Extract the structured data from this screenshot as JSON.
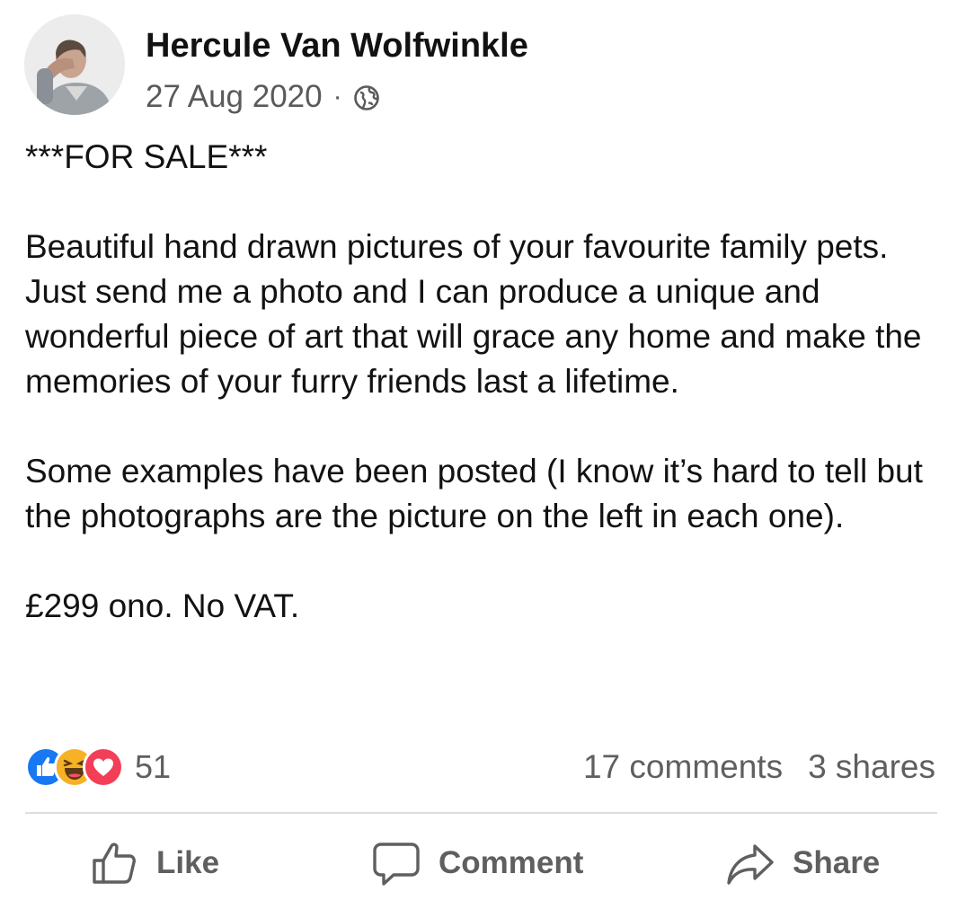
{
  "post": {
    "author": "Hercule Van Wolfwinkle",
    "date": "27 Aug 2020",
    "separator": "·",
    "privacy_icon": "globe-icon",
    "body": {
      "heading": "***FOR SALE***",
      "paragraph1": "Beautiful hand drawn pictures of your favourite family pets. Just send me a photo and I can produce a unique and wonderful piece of art that will grace any home and make the memories of your furry friends last a lifetime.",
      "paragraph2": "Some examples have been posted (I know it’s hard to tell but the photographs are the picture on the left in each one).",
      "price": "£299 ono. No VAT."
    }
  },
  "stats": {
    "reactions": [
      {
        "icon": "like-reaction-icon",
        "color": "#1877f2"
      },
      {
        "icon": "haha-reaction-icon",
        "color": "#f7b125"
      },
      {
        "icon": "love-reaction-icon",
        "color": "#f33e58"
      }
    ],
    "reaction_count": "51",
    "comments": "17 comments",
    "shares": "3 shares"
  },
  "actions": {
    "like": {
      "label": "Like",
      "icon": "thumbs-up-icon"
    },
    "comment": {
      "label": "Comment",
      "icon": "speech-bubble-icon"
    },
    "share": {
      "label": "Share",
      "icon": "share-arrow-icon"
    }
  },
  "colors": {
    "text": "#121212",
    "secondary_text": "#5f5f5f",
    "divider": "#dedede"
  }
}
